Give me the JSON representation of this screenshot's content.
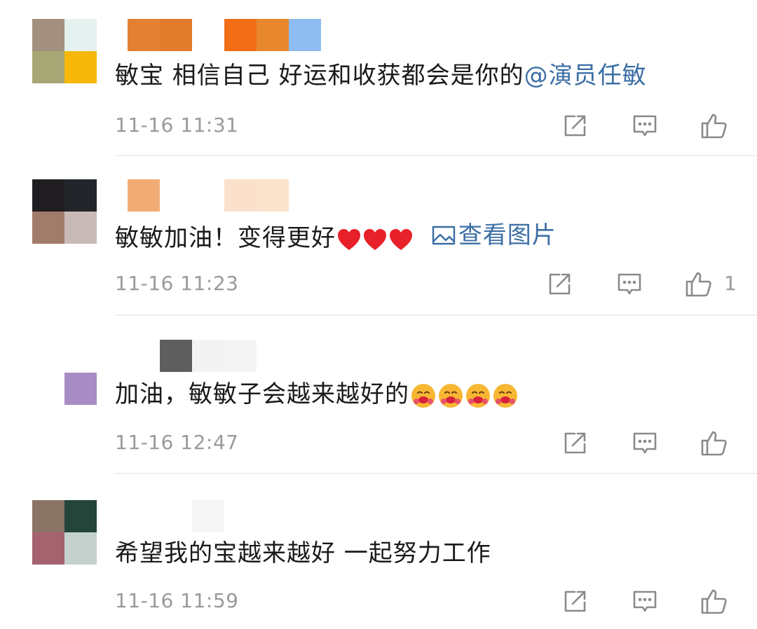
{
  "comments": [
    {
      "text": "敏宝 相信自己 好运和收获都会是你的",
      "mention": "@演员任敏",
      "timestamp": "11-16 11:31",
      "like_count": ""
    },
    {
      "text": "敏敏加油！变得更好",
      "view_image_label": "查看图片",
      "timestamp": "11-16 11:23",
      "like_count": "1"
    },
    {
      "text": "加油，敏敏子会越来越好的",
      "timestamp": "11-16 12:47",
      "like_count": ""
    },
    {
      "text": "希望我的宝越来越好 一起努力工作",
      "timestamp": "11-16 11:59",
      "like_count": ""
    }
  ],
  "icons": {
    "repost": "repost-icon",
    "comment": "comment-icon",
    "like": "like-icon",
    "heart": "heart-emoji-icon",
    "emoji": "hugging-face-emoji-icon",
    "image": "image-icon"
  },
  "colors": {
    "link": "#3b6ea5",
    "text": "#1a1a1a",
    "meta": "#9a9a9a",
    "divider": "#efefef",
    "heart": "#e8202a",
    "emoji": "#f7b733"
  }
}
